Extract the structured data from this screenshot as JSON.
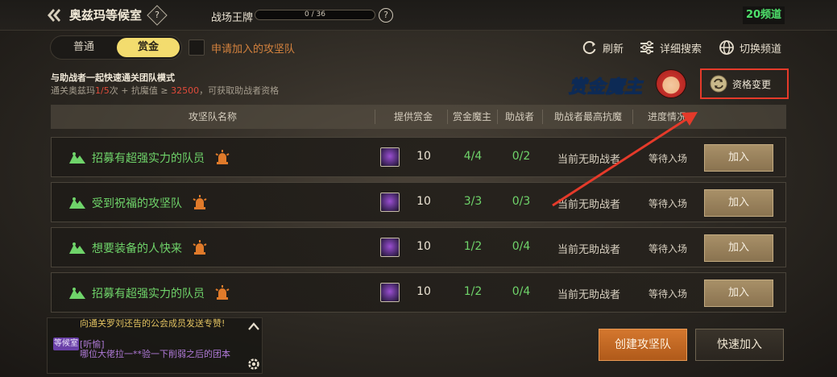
{
  "header": {
    "title": "奥兹玛等候室",
    "help_symbol": "?",
    "rank_label": "战场王牌",
    "rank_progress_text": "0 / 36",
    "rank_progress_fraction": 0,
    "rank_help_symbol": "?",
    "channel": "20频道"
  },
  "tabs": [
    {
      "label": "普通",
      "active": false
    },
    {
      "label": "赏金",
      "active": true
    }
  ],
  "apply_checkbox_label": "申请加入的攻坚队",
  "tools": {
    "refresh": "刷新",
    "detail_search": "详细搜索",
    "switch_channel": "切换频道"
  },
  "info": {
    "line1": "与助战者一起快速通关团队模式",
    "line2_prefix": "通关奥兹玛",
    "line2_count": "1/5",
    "line2_mid": "次 + 抗魔值 ≥ ",
    "line2_value": "32500",
    "line2_suffix": "，可获取助战者资格"
  },
  "brand_logo_text": "赏金魔主",
  "qualification_button": "资格变更",
  "columns": [
    "攻坚队名称",
    "提供赏金",
    "赏金魔主",
    "助战者",
    "助战者最高抗魔",
    "进度情况"
  ],
  "rows": [
    {
      "name": "招募有超强实力的队员",
      "reward": "10",
      "boss": "4/4",
      "helpers": "0/2",
      "max_resist": "当前无助战者",
      "progress": "等待入场",
      "join": "加入"
    },
    {
      "name": "受到祝福的攻坚队",
      "reward": "10",
      "boss": "3/3",
      "helpers": "0/3",
      "max_resist": "当前无助战者",
      "progress": "等待入场",
      "join": "加入"
    },
    {
      "name": "想要装备的人快来",
      "reward": "10",
      "boss": "1/2",
      "helpers": "0/4",
      "max_resist": "当前无助战者",
      "progress": "等待入场",
      "join": "加入"
    },
    {
      "name": "招募有超强实力的队员",
      "reward": "10",
      "boss": "1/2",
      "helpers": "0/4",
      "max_resist": "当前无助战者",
      "progress": "等待入场",
      "join": "加入"
    }
  ],
  "chat": {
    "line_top": "向通关罗刘还告的公会成员发送专赞!",
    "badge": "等候室",
    "sender": "[听愉]",
    "message": "哪位大佬拉一**验一下削弱之后的团本"
  },
  "buttons": {
    "create": "创建攻坚队",
    "quick_join": "快速加入"
  },
  "colors": {
    "accent_green": "#6fd46a",
    "tab_active": "#f3dc6e",
    "highlight_red": "#e53a2a",
    "create_orange": "#c8692a",
    "channel_green": "#4ee06b"
  }
}
